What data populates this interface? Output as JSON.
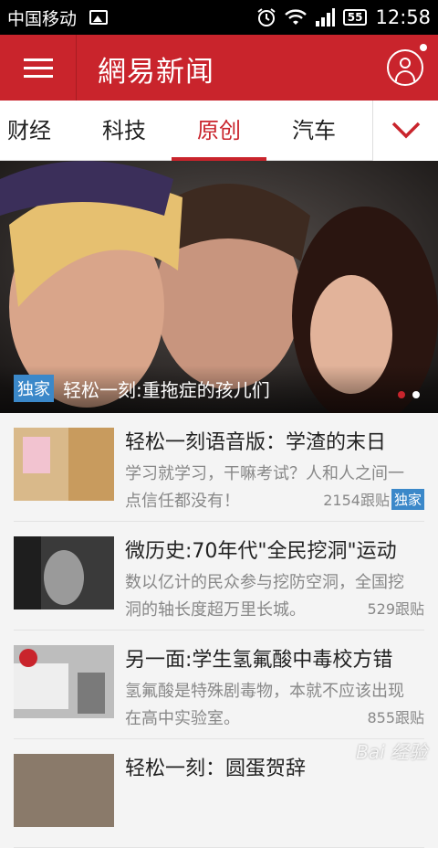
{
  "status": {
    "carrier": "中国移动",
    "battery": "55",
    "time": "12:58"
  },
  "appbar": {
    "logo": "網易新闻"
  },
  "tabs": [
    {
      "label": "财经"
    },
    {
      "label": "科技"
    },
    {
      "label": "原创",
      "active": true
    },
    {
      "label": "汽车"
    }
  ],
  "hero": {
    "badge": "独家",
    "title": "轻松一刻:重拖症的孩儿们"
  },
  "news": [
    {
      "title": "轻松一刻语音版：学渣的末日",
      "desc": "学习就学习，干嘛考试？人和人之间一点信任都没有！",
      "count": "2154跟贴",
      "tag": "独家"
    },
    {
      "title": "微历史:70年代\"全民挖洞\"运动",
      "desc": "数以亿计的民众参与挖防空洞，全国挖洞的轴长度超万里长城。",
      "count": "529跟贴",
      "tag": ""
    },
    {
      "title": "另一面:学生氢氟酸中毒校方错",
      "desc": "氢氟酸是特殊剧毒物，本就不应该出现在高中实验室。",
      "count": "855跟贴",
      "tag": ""
    },
    {
      "title": "轻松一刻：圆蛋贺辞",
      "desc": "",
      "count": "",
      "tag": ""
    }
  ],
  "watermark": "Bai 经验"
}
